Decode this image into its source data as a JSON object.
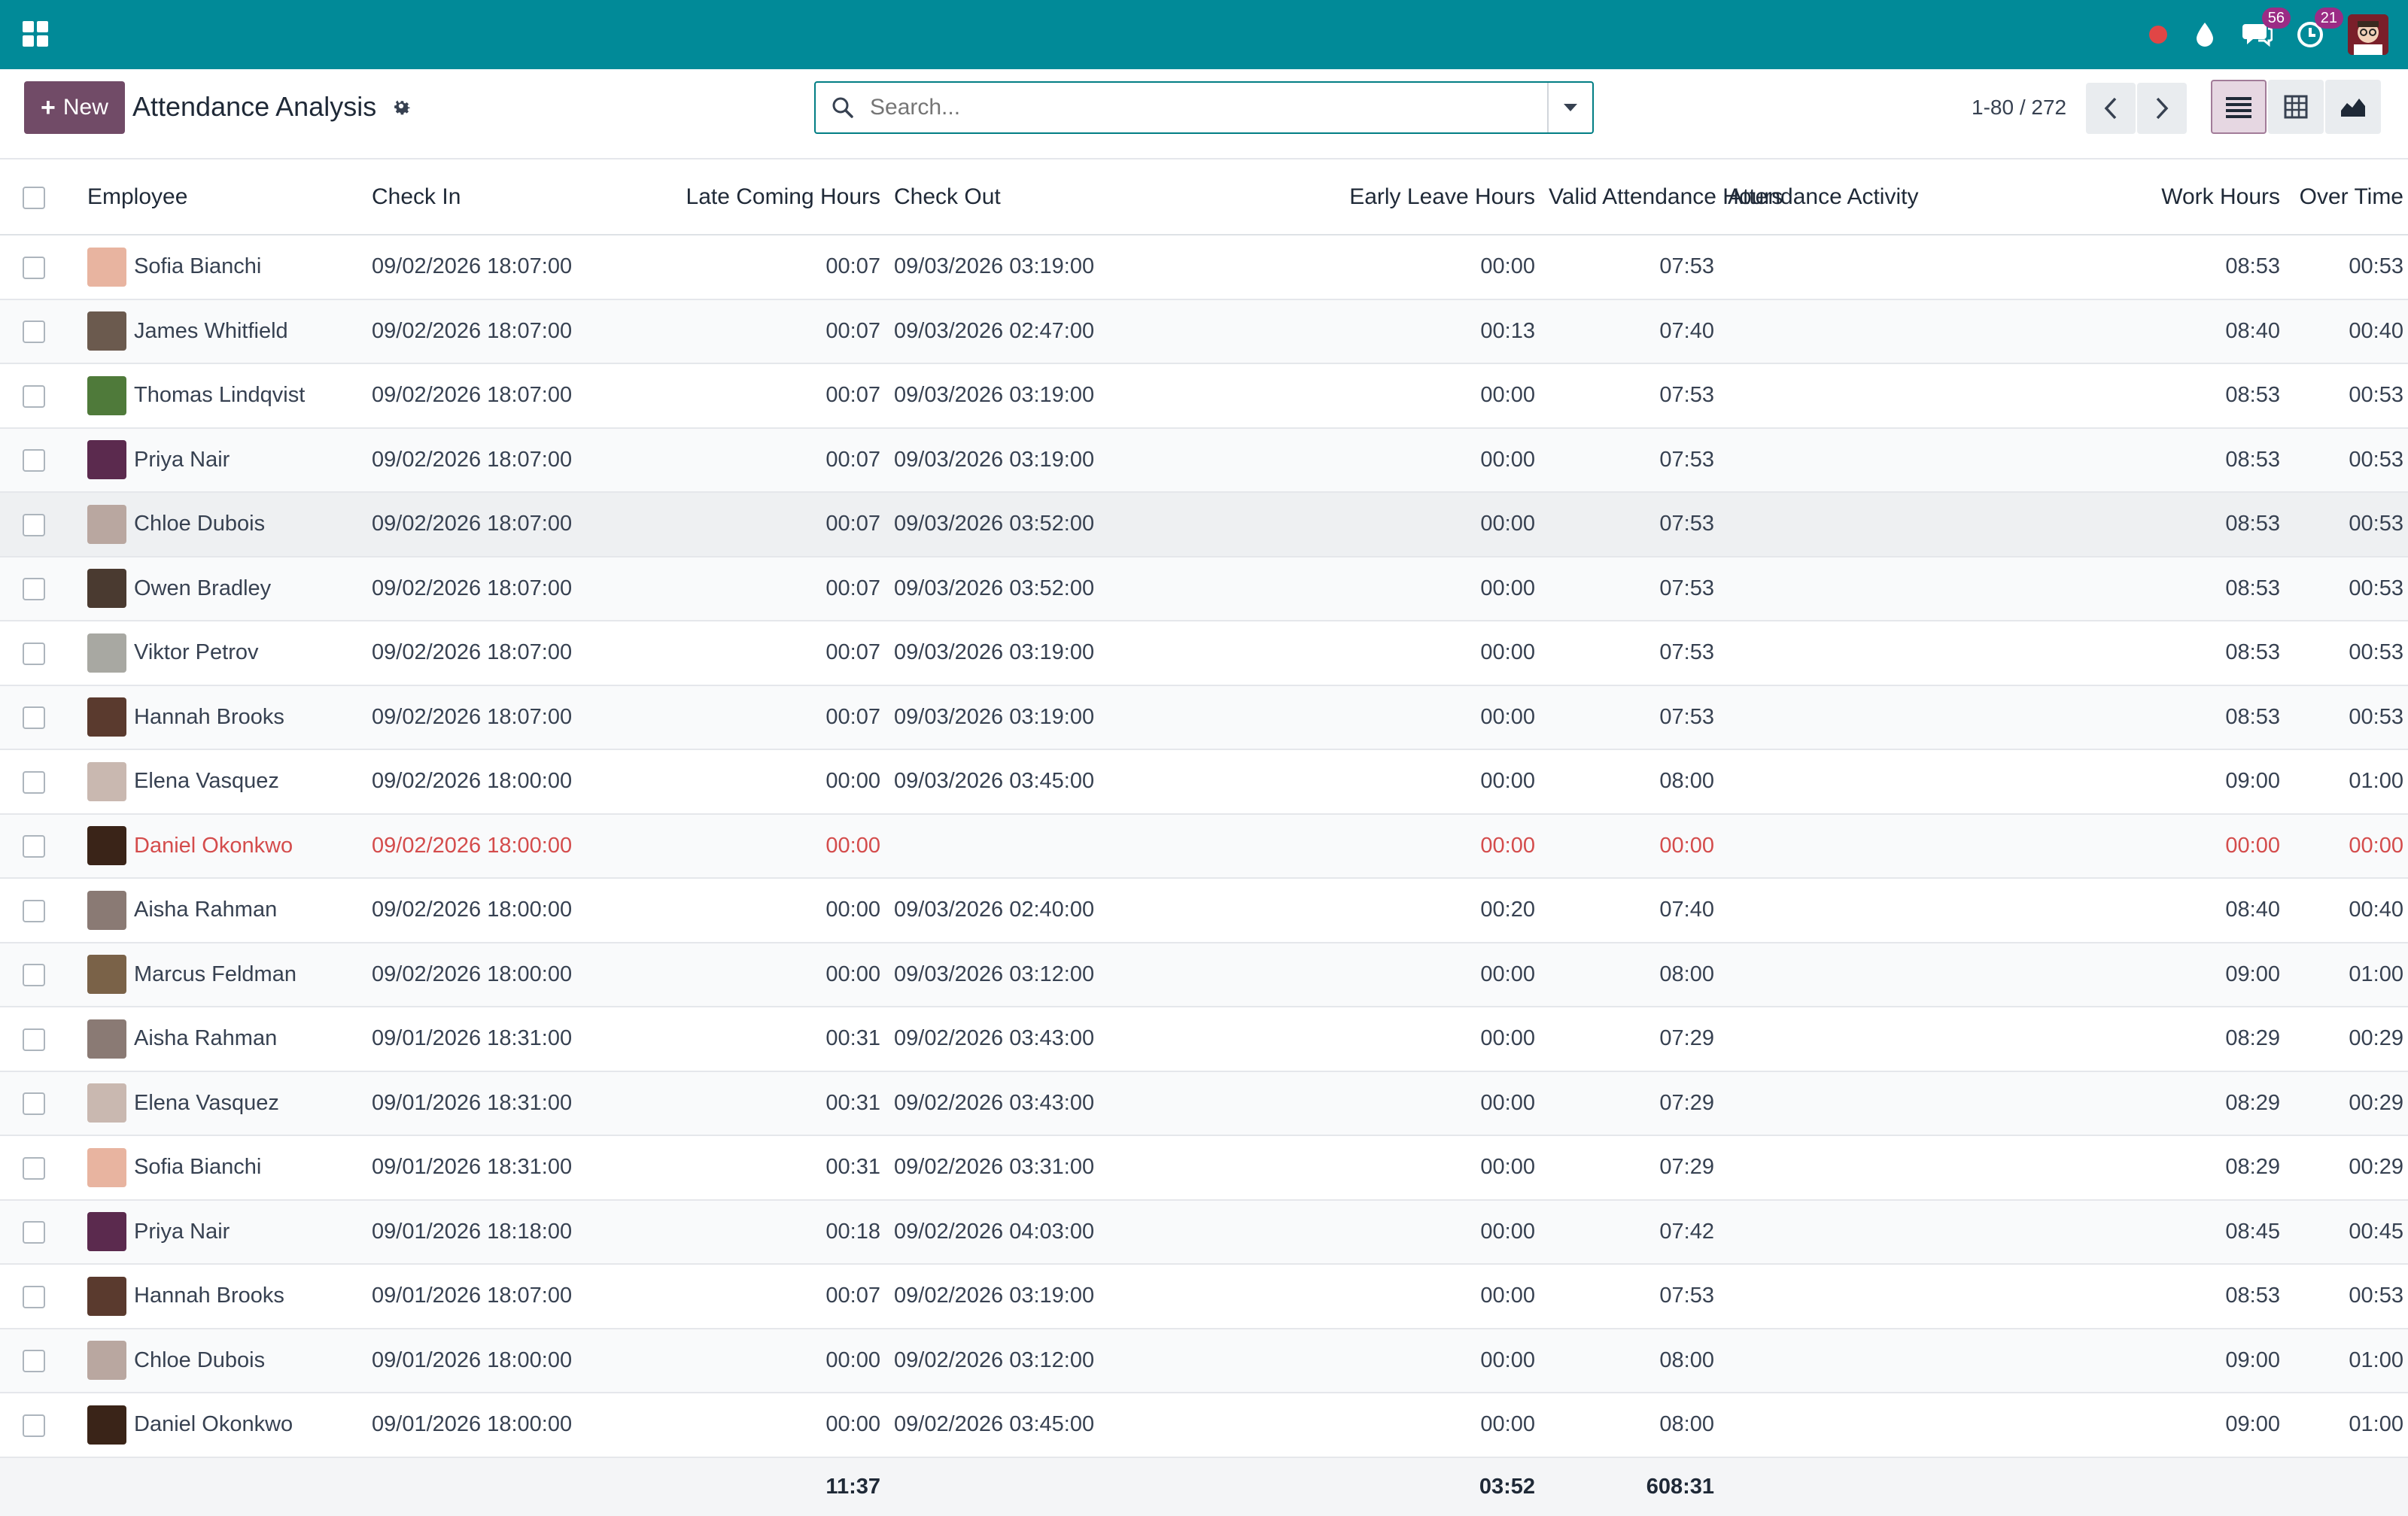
{
  "navbar": {
    "messages_count": "56",
    "activities_count": "21"
  },
  "control": {
    "new_label": "New",
    "new_icon": "plus-icon",
    "title": "Attendance Analysis",
    "search_placeholder": "Search...",
    "pager": "1-80 / 272"
  },
  "columns": [
    "Employee",
    "Check In",
    "Late Coming Hours",
    "Check Out",
    "Early Leave Hours",
    "Valid Attendance Hours",
    "Attendance Activity",
    "Work Hours",
    "Over Time"
  ],
  "rows": [
    {
      "employee": "Sofia Bianchi",
      "check_in": "09/02/2026 18:07:00",
      "late": "00:07",
      "check_out": "09/03/2026 03:19:00",
      "early": "00:00",
      "valid": "07:53",
      "activity": "",
      "work": "08:53",
      "overtime": "00:53",
      "avatar_color": "#e8b4a0"
    },
    {
      "employee": "James Whitfield",
      "check_in": "09/02/2026 18:07:00",
      "late": "00:07",
      "check_out": "09/03/2026 02:47:00",
      "early": "00:13",
      "valid": "07:40",
      "activity": "",
      "work": "08:40",
      "overtime": "00:40",
      "avatar_color": "#6b5a4e"
    },
    {
      "employee": "Thomas Lindqvist",
      "check_in": "09/02/2026 18:07:00",
      "late": "00:07",
      "check_out": "09/03/2026 03:19:00",
      "early": "00:00",
      "valid": "07:53",
      "activity": "",
      "work": "08:53",
      "overtime": "00:53",
      "avatar_color": "#4f7a3a"
    },
    {
      "employee": "Priya Nair",
      "check_in": "09/02/2026 18:07:00",
      "late": "00:07",
      "check_out": "09/03/2026 03:19:00",
      "early": "00:00",
      "valid": "07:53",
      "activity": "",
      "work": "08:53",
      "overtime": "00:53",
      "avatar_color": "#5b2a4e"
    },
    {
      "employee": "Chloe Dubois",
      "check_in": "09/02/2026 18:07:00",
      "late": "00:07",
      "check_out": "09/03/2026 03:52:00",
      "early": "00:00",
      "valid": "07:53",
      "activity": "",
      "work": "08:53",
      "overtime": "00:53",
      "avatar_color": "#b9a7a0"
    },
    {
      "employee": "Owen Bradley",
      "check_in": "09/02/2026 18:07:00",
      "late": "00:07",
      "check_out": "09/03/2026 03:52:00",
      "early": "00:00",
      "valid": "07:53",
      "activity": "",
      "work": "08:53",
      "overtime": "00:53",
      "avatar_color": "#4a3a30"
    },
    {
      "employee": "Viktor Petrov",
      "check_in": "09/02/2026 18:07:00",
      "late": "00:07",
      "check_out": "09/03/2026 03:19:00",
      "early": "00:00",
      "valid": "07:53",
      "activity": "",
      "work": "08:53",
      "overtime": "00:53",
      "avatar_color": "#a8a8a2"
    },
    {
      "employee": "Hannah Brooks",
      "check_in": "09/02/2026 18:07:00",
      "late": "00:07",
      "check_out": "09/03/2026 03:19:00",
      "early": "00:00",
      "valid": "07:53",
      "activity": "",
      "work": "08:53",
      "overtime": "00:53",
      "avatar_color": "#5a3a2e"
    },
    {
      "employee": "Elena Vasquez",
      "check_in": "09/02/2026 18:00:00",
      "late": "00:00",
      "check_out": "09/03/2026 03:45:00",
      "early": "00:00",
      "valid": "08:00",
      "activity": "",
      "work": "09:00",
      "overtime": "01:00",
      "avatar_color": "#c9b8b0"
    },
    {
      "employee": "Daniel Okonkwo",
      "check_in": "09/02/2026 18:00:00",
      "late": "00:00",
      "check_out": "",
      "early": "00:00",
      "valid": "00:00",
      "activity": "",
      "work": "00:00",
      "overtime": "00:00",
      "avatar_color": "#3a2418",
      "danger": true
    },
    {
      "employee": "Aisha Rahman",
      "check_in": "09/02/2026 18:00:00",
      "late": "00:00",
      "check_out": "09/03/2026 02:40:00",
      "early": "00:20",
      "valid": "07:40",
      "activity": "",
      "work": "08:40",
      "overtime": "00:40",
      "avatar_color": "#8a7a74"
    },
    {
      "employee": "Marcus Feldman",
      "check_in": "09/02/2026 18:00:00",
      "late": "00:00",
      "check_out": "09/03/2026 03:12:00",
      "early": "00:00",
      "valid": "08:00",
      "activity": "",
      "work": "09:00",
      "overtime": "01:00",
      "avatar_color": "#7a6248"
    },
    {
      "employee": "Aisha Rahman",
      "check_in": "09/01/2026 18:31:00",
      "late": "00:31",
      "check_out": "09/02/2026 03:43:00",
      "early": "00:00",
      "valid": "07:29",
      "activity": "",
      "work": "08:29",
      "overtime": "00:29",
      "avatar_color": "#8a7a74"
    },
    {
      "employee": "Elena Vasquez",
      "check_in": "09/01/2026 18:31:00",
      "late": "00:31",
      "check_out": "09/02/2026 03:43:00",
      "early": "00:00",
      "valid": "07:29",
      "activity": "",
      "work": "08:29",
      "overtime": "00:29",
      "avatar_color": "#c9b8b0"
    },
    {
      "employee": "Sofia Bianchi",
      "check_in": "09/01/2026 18:31:00",
      "late": "00:31",
      "check_out": "09/02/2026 03:31:00",
      "early": "00:00",
      "valid": "07:29",
      "activity": "",
      "work": "08:29",
      "overtime": "00:29",
      "avatar_color": "#e8b4a0"
    },
    {
      "employee": "Priya Nair",
      "check_in": "09/01/2026 18:18:00",
      "late": "00:18",
      "check_out": "09/02/2026 04:03:00",
      "early": "00:00",
      "valid": "07:42",
      "activity": "",
      "work": "08:45",
      "overtime": "00:45",
      "avatar_color": "#5b2a4e"
    },
    {
      "employee": "Hannah Brooks",
      "check_in": "09/01/2026 18:07:00",
      "late": "00:07",
      "check_out": "09/02/2026 03:19:00",
      "early": "00:00",
      "valid": "07:53",
      "activity": "",
      "work": "08:53",
      "overtime": "00:53",
      "avatar_color": "#5a3a2e"
    },
    {
      "employee": "Chloe Dubois",
      "check_in": "09/01/2026 18:00:00",
      "late": "00:00",
      "check_out": "09/02/2026 03:12:00",
      "early": "00:00",
      "valid": "08:00",
      "activity": "",
      "work": "09:00",
      "overtime": "01:00",
      "avatar_color": "#b9a7a0"
    },
    {
      "employee": "Daniel Okonkwo",
      "check_in": "09/01/2026 18:00:00",
      "late": "00:00",
      "check_out": "09/02/2026 03:45:00",
      "early": "00:00",
      "valid": "08:00",
      "activity": "",
      "work": "09:00",
      "overtime": "01:00",
      "avatar_color": "#3a2418"
    }
  ],
  "totals": {
    "late": "11:37",
    "early": "03:52",
    "valid": "608:31"
  },
  "colors": {
    "navbar": "#018a98",
    "primary": "#714b67",
    "danger": "#d44c4c",
    "search_border": "#017e84"
  }
}
